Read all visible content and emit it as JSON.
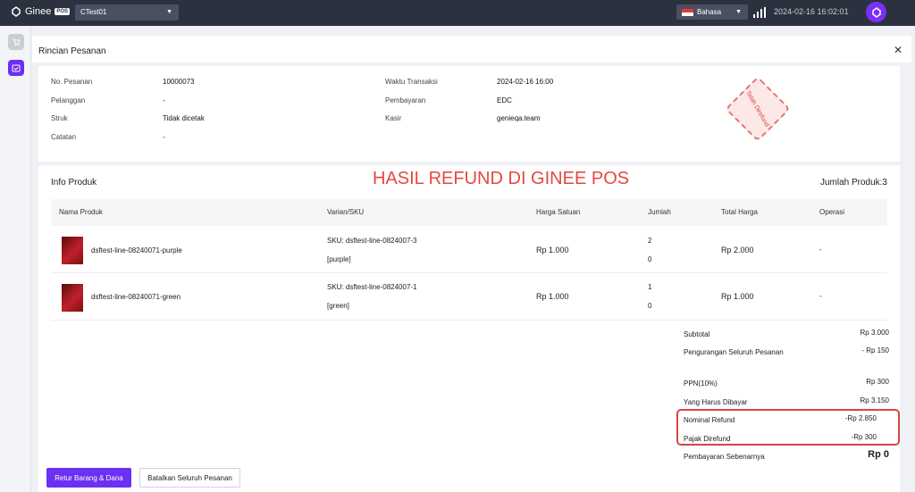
{
  "topbar": {
    "logo_text": "Ginee",
    "logo_badge": "POS",
    "store": "CTest01",
    "language": "Bahasa",
    "datetime": "2024-02-16 16:02:01"
  },
  "panel": {
    "title": "Rincian Pesanan"
  },
  "order_info": {
    "left": [
      {
        "label": "No. Pesanan",
        "value": "10000073"
      },
      {
        "label": "Pelanggan",
        "value": "-"
      },
      {
        "label": "Struk",
        "value": "Tidak dicetak"
      },
      {
        "label": "Catatan",
        "value": "-"
      }
    ],
    "right": [
      {
        "label": "Waktu Transaksi",
        "value": "2024-02-16 16:00"
      },
      {
        "label": "Pembayaran",
        "value": "EDC"
      },
      {
        "label": "Kasir",
        "value": "genieqa.team"
      }
    ],
    "stamp": "Telah Direfund"
  },
  "products": {
    "section_title": "Info Produk",
    "banner": "HASIL REFUND DI GINEE POS",
    "count_label": "Jumlah Produk:3",
    "columns": [
      "Nama Produk",
      "Varian/SKU",
      "Harga Satuan",
      "Jumlah",
      "Total Harga",
      "Operasi"
    ],
    "rows": [
      {
        "name": "dsftest-line-08240071-purple",
        "sku": "SKU: dsftest-line-0824007-3",
        "variant": "[purple]",
        "price": "Rp 1.000",
        "qty": "2",
        "qty_refund": "0",
        "total": "Rp 2.000",
        "operation": "-"
      },
      {
        "name": "dsftest-line-08240071-green",
        "sku": "SKU: dsftest-line-0824007-1",
        "variant": "[green]",
        "price": "Rp 1.000",
        "qty": "1",
        "qty_refund": "0",
        "total": "Rp 1.000",
        "operation": "-"
      }
    ]
  },
  "summary": {
    "subtotal_label": "Subtotal",
    "subtotal": "Rp 3.000",
    "discount_label": "Pengurangan Seluruh Pesanan",
    "discount": "- Rp 150",
    "tax_label": "PPN(10%)",
    "tax": "Rp 300",
    "due_label": "Yang Harus Dibayar",
    "due": "Rp 3.150",
    "refund_label": "Nominal Refund",
    "refund": "-Rp 2.850",
    "tax_refund_label": "Pajak Direfund",
    "tax_refund": "-Rp 300",
    "actual_label": "Pembayaran Sebenarnya",
    "actual": "Rp 0"
  },
  "actions": {
    "return_label": "Retur Barang & Dana",
    "cancel_label": "Batalkan Seluruh Pesanan"
  },
  "colors": {
    "accent": "#6b30f2",
    "banner": "#e5483f",
    "topbar": "#2c3140"
  }
}
